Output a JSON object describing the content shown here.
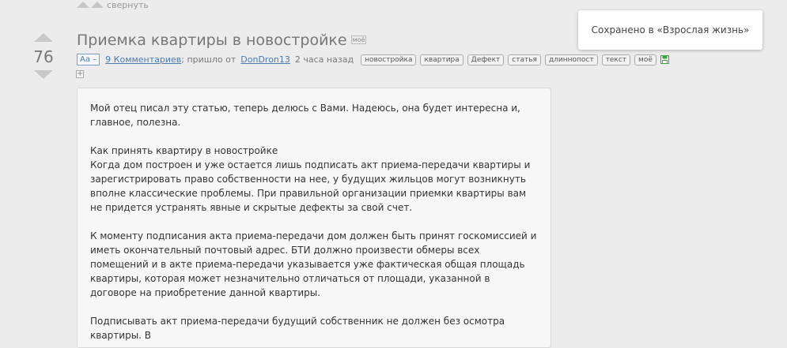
{
  "collapse": {
    "label": "свернуть"
  },
  "post": {
    "score": "76",
    "title": "Приемка квартиры в новостройке",
    "mine_label": "моё",
    "font_button": "Аа –",
    "comments_link": "9 Комментариев",
    "from_text": "; пришло от",
    "author": "DonDron13",
    "time": "2 часа назад",
    "tags": [
      "новостройка",
      "квартира",
      "Дефект",
      "статья",
      "длиннопост",
      "текст",
      "моё"
    ],
    "expand_label": "+"
  },
  "content": {
    "p1": "Мой отец писал эту статью, теперь делюсь с Вами. Надеюсь, она будет интересна и, главное, полезна.",
    "p2_heading": "Как принять квартиру в новостройке",
    "p2_body": "Когда дом построен и уже остается лишь подписать акт приема-передачи квартиры и зарегистрировать право собственности на нее, у будущих жильцов могут возникнуть вполне классические проблемы. При правильной организации приемки квартиры вам не придется устранять явные и скрытые дефекты за свой счет.",
    "p3": "К моменту подписания акта приема-передачи дом должен быть принят госкомиссией и иметь окончательный почтовый адрес. БТИ должно произвести обмеры всех помещений и в акте приема-передачи указывается уже фактическая общая площадь квартиры, которая может незначительно отличаться от площади, указанной в договоре на приобретение данной квартиры.",
    "p4": "Подписывать акт приема-передачи будущий собственник не должен без осмотра квартиры. В"
  },
  "toast": {
    "message": "Сохранено в «Взрослая жизнь»"
  },
  "colors": {
    "link": "#4a7ab0",
    "save_icon": "#3aa53a"
  }
}
